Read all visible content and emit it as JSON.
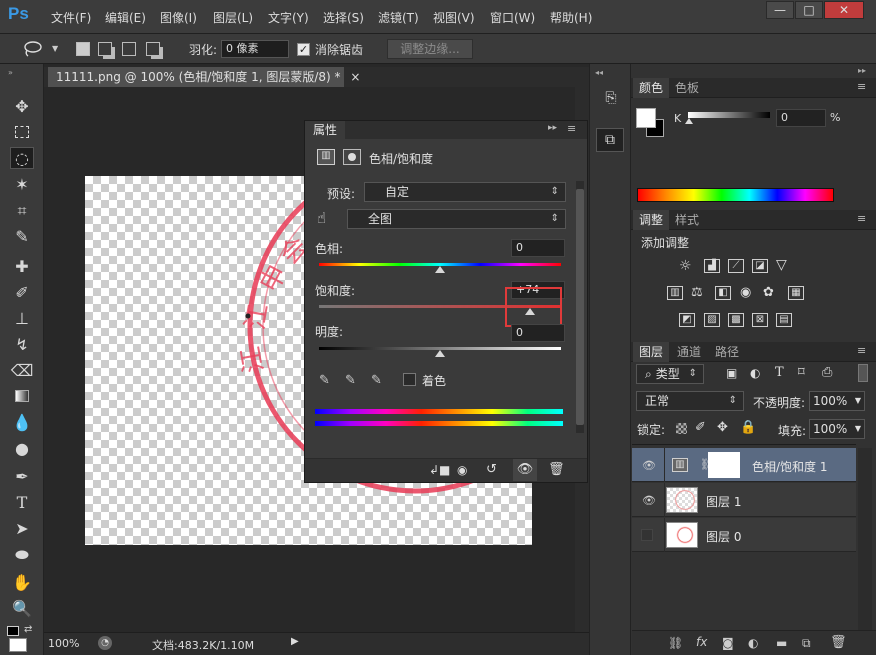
{
  "app": {
    "logo": "Ps"
  },
  "menu": [
    "文件(F)",
    "编辑(E)",
    "图像(I)",
    "图层(L)",
    "文字(Y)",
    "选择(S)",
    "滤镜(T)",
    "视图(V)",
    "窗口(W)",
    "帮助(H)"
  ],
  "window_controls": {
    "minimize": "—",
    "maximize": "□",
    "close": "✕"
  },
  "options_bar": {
    "feather_label": "羽化:",
    "feather_value": "0 像素",
    "antialias_label": "消除锯齿",
    "antialias_checked": true,
    "refine_edge_label": "调整边缘..."
  },
  "document": {
    "tab_title": "11111.png @ 100% (色相/饱和度 1, 图层蒙版/8) *",
    "tab_close": "×",
    "zoom": "100%",
    "doc_info": "文档:483.2K/1.10M"
  },
  "properties_panel": {
    "tab_label": "属性",
    "title": "色相/饱和度",
    "preset_label": "预设:",
    "preset_value": "自定",
    "channel_value": "全图",
    "hue_label": "色相:",
    "hue_value": "0",
    "saturation_label": "饱和度:",
    "saturation_value": "+74",
    "lightness_label": "明度:",
    "lightness_value": "0",
    "colorize_label": "着色",
    "colorize_checked": false,
    "hue_slider_position": 0.5,
    "saturation_slider_position": 0.87,
    "lightness_slider_position": 0.5,
    "highlight_color": "#e03a3a"
  },
  "color_panel": {
    "tabs": [
      "颜色",
      "色板"
    ],
    "k_label": "K",
    "k_value": "0",
    "k_unit": "%"
  },
  "adjustments_panel": {
    "tabs": [
      "调整",
      "样式"
    ],
    "title": "添加调整"
  },
  "layers_panel": {
    "tabs": [
      "图层",
      "通道",
      "路径"
    ],
    "filter_kind": "类型",
    "blend_mode": "正常",
    "opacity_label": "不透明度:",
    "opacity_value": "100%",
    "lock_label": "锁定:",
    "fill_label": "填充:",
    "fill_value": "100%",
    "layers": [
      {
        "name": "色相/饱和度 1",
        "visible": true,
        "selected": true
      },
      {
        "name": "图层 1",
        "visible": true,
        "selected": false
      },
      {
        "name": "图层 0",
        "visible": false,
        "selected": false
      }
    ]
  }
}
